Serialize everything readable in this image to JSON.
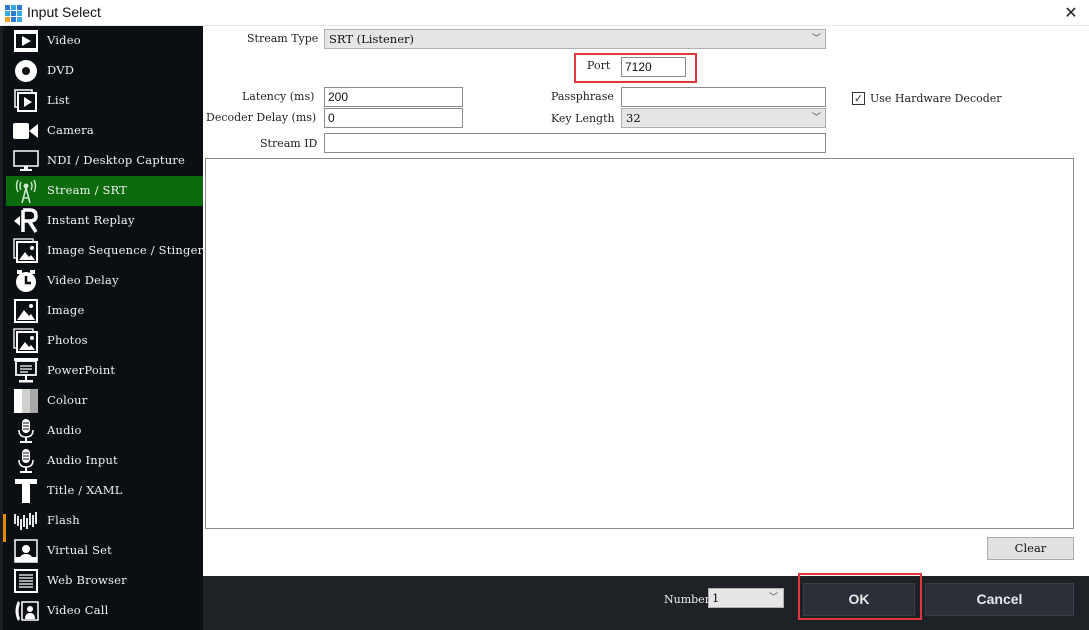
{
  "window": {
    "title": "Input Select",
    "close_icon": "close-icon"
  },
  "sidebar": {
    "active_index": 5,
    "items": [
      {
        "label": "Video",
        "icon": "film-play-icon"
      },
      {
        "label": "DVD",
        "icon": "disc-icon"
      },
      {
        "label": "List",
        "icon": "list-play-icon"
      },
      {
        "label": "Camera",
        "icon": "camera-icon"
      },
      {
        "label": "NDI / Desktop Capture",
        "icon": "monitor-icon"
      },
      {
        "label": "Stream / SRT",
        "icon": "antenna-icon"
      },
      {
        "label": "Instant Replay",
        "icon": "replay-icon"
      },
      {
        "label": "Image Sequence / Stinger",
        "icon": "image-stack-icon"
      },
      {
        "label": "Video Delay",
        "icon": "clock-icon"
      },
      {
        "label": "Image",
        "icon": "image-icon"
      },
      {
        "label": "Photos",
        "icon": "photos-icon"
      },
      {
        "label": "PowerPoint",
        "icon": "presentation-icon"
      },
      {
        "label": "Colour",
        "icon": "colour-icon"
      },
      {
        "label": "Audio",
        "icon": "microphone-icon"
      },
      {
        "label": "Audio Input",
        "icon": "microphone-icon"
      },
      {
        "label": "Title / XAML",
        "icon": "title-t-icon"
      },
      {
        "label": "Flash",
        "icon": "waveform-icon"
      },
      {
        "label": "Virtual Set",
        "icon": "person-frame-icon"
      },
      {
        "label": "Web Browser",
        "icon": "browser-icon"
      },
      {
        "label": "Video Call",
        "icon": "phone-person-icon"
      }
    ]
  },
  "form": {
    "stream_type": {
      "label": "Stream Type",
      "value": "SRT (Listener)"
    },
    "port": {
      "label": "Port",
      "value": "7120"
    },
    "latency": {
      "label": "Latency (ms)",
      "value": "200"
    },
    "decoder_delay": {
      "label": "Decoder Delay (ms)",
      "value": "0"
    },
    "passphrase": {
      "label": "Passphrase",
      "value": ""
    },
    "key_length": {
      "label": "Key Length",
      "value": "32"
    },
    "stream_id": {
      "label": "Stream ID",
      "value": ""
    },
    "hardware_decoder": {
      "label": "Use Hardware Decoder",
      "checked": true,
      "check_glyph": "✓"
    },
    "clear_label": "Clear"
  },
  "footer": {
    "number_label": "Number",
    "number_value": "1",
    "ok_label": "OK",
    "cancel_label": "Cancel"
  },
  "colors": {
    "active_item": "#0b6a0b",
    "highlight": "#e0373c",
    "sidebar_bg": "#0b0f13",
    "footer_bg": "#1e2126"
  }
}
